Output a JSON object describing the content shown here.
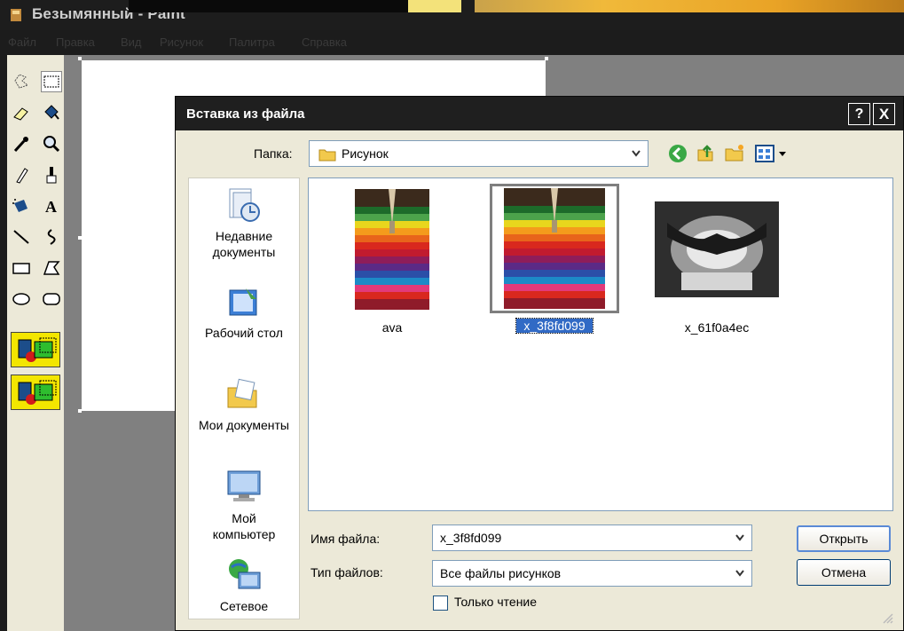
{
  "paint": {
    "title": "Безымянный - Paint",
    "menu": [
      "Файл",
      "Правка",
      "Вид",
      "Рисунок",
      "Палитра",
      "Справка"
    ]
  },
  "dialog": {
    "title": "Вставка из файла",
    "help_label": "?",
    "close_label": "X",
    "folder_label": "Папка:",
    "folder_value": "Рисунок",
    "places": [
      {
        "label": "Недавние документы",
        "icon": "recent-documents-icon"
      },
      {
        "label": "Рабочий стол",
        "icon": "desktop-icon"
      },
      {
        "label": "Мои документы",
        "icon": "my-documents-icon"
      },
      {
        "label": "Мой компьютер",
        "icon": "my-computer-icon"
      },
      {
        "label": "Сетевое",
        "icon": "network-icon"
      }
    ],
    "files": [
      {
        "name": "ava",
        "selected": false
      },
      {
        "name": "x_3f8fd099",
        "selected": true
      },
      {
        "name": "x_61f0a4ec",
        "selected": false
      }
    ],
    "filename_label": "Имя файла:",
    "filename_value": "x_3f8fd099",
    "filetype_label": "Тип файлов:",
    "filetype_value": "Все файлы рисунков",
    "readonly_label": "Только чтение",
    "readonly_checked": false,
    "open_label": "Открыть",
    "cancel_label": "Отмена"
  },
  "colors": {
    "accent_selection": "#316ac5",
    "dialog_bg": "#ece9d8"
  }
}
